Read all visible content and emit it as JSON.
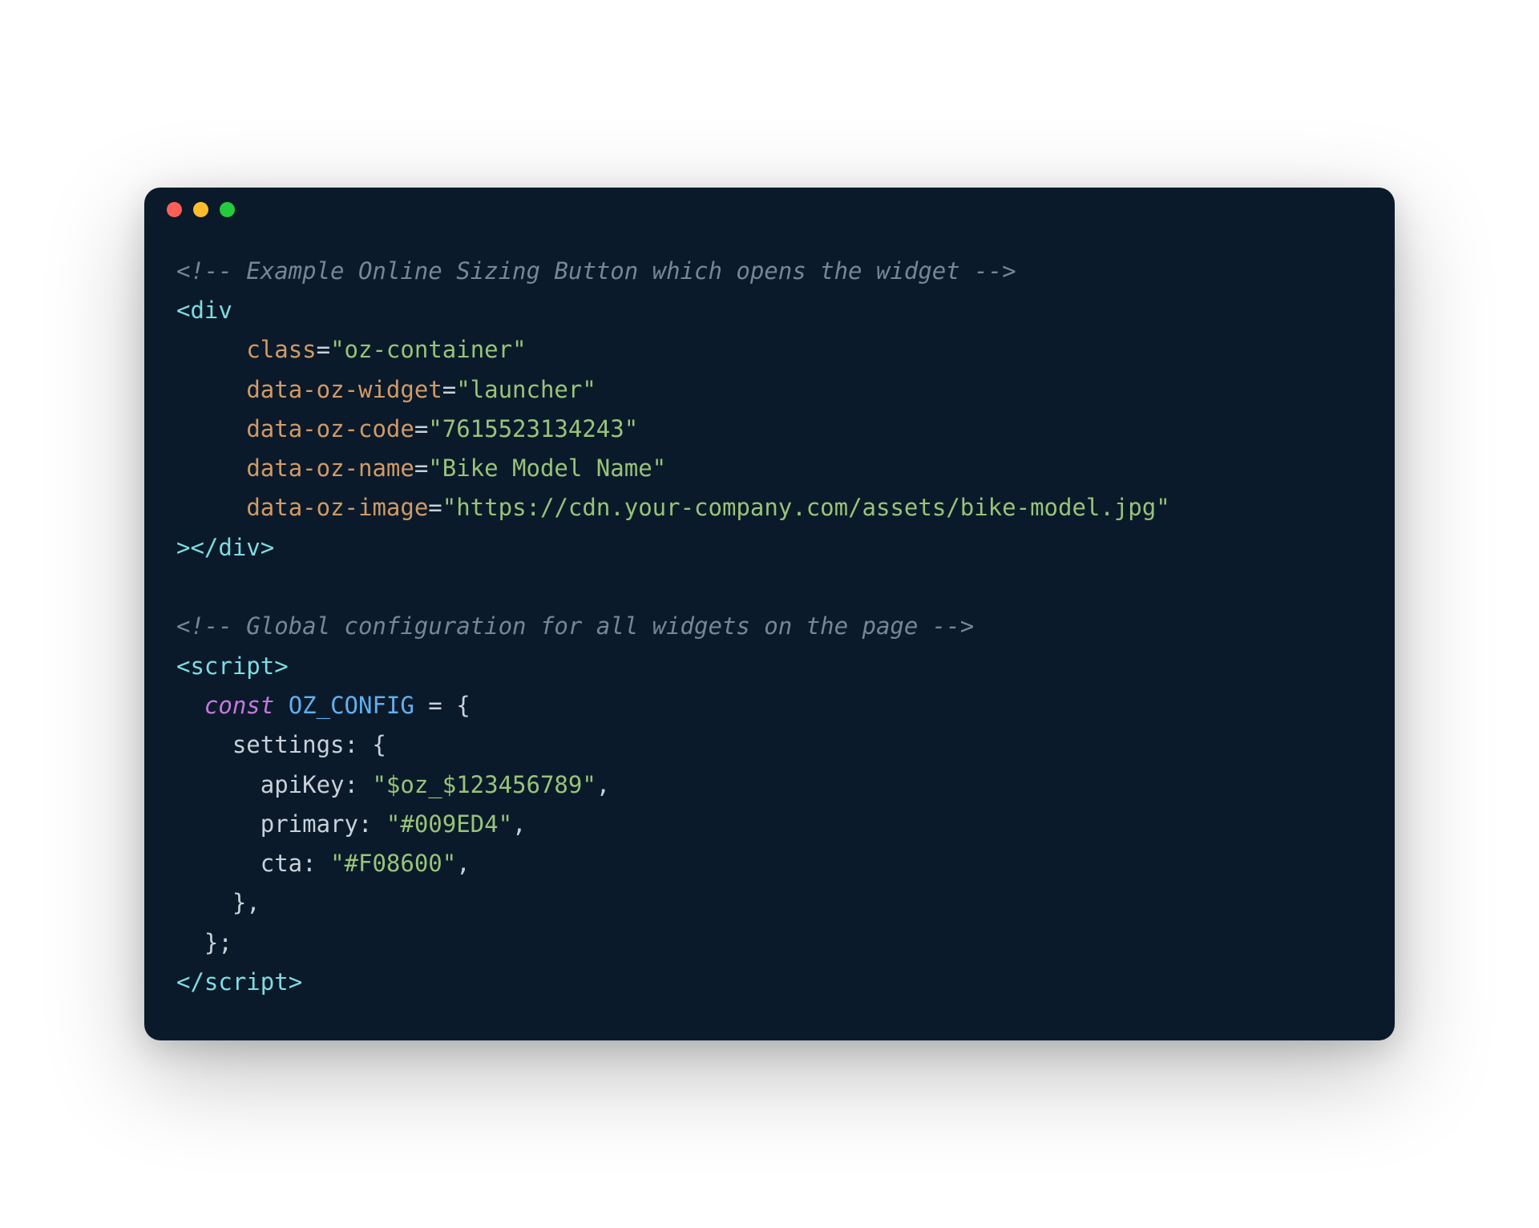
{
  "window": {
    "traffic_lights": {
      "red": "#ff5f56",
      "yellow": "#ffbd2e",
      "green": "#27c93f"
    }
  },
  "code": {
    "line01_comment": "<!-- Example Online Sizing Button which opens the widget -->",
    "line02_tag_open": "<",
    "line02_tag_name": "div",
    "line03_attr": "class",
    "line03_val": "\"oz-container\"",
    "line04_attr": "data-oz-widget",
    "line04_val": "\"launcher\"",
    "line05_attr": "data-oz-code",
    "line05_val": "\"7615523134243\"",
    "line06_attr": "data-oz-name",
    "line06_val": "\"Bike Model Name\"",
    "line07_attr": "data-oz-image",
    "line07_val": "\"https://cdn.your-company.com/assets/bike-model.jpg\"",
    "line08_close_open": ">",
    "line08_close_slash": "</",
    "line08_close_name": "div",
    "line08_close_end": ">",
    "line10_comment": "<!-- Global configuration for all widgets on the page -->",
    "line11_open": "<",
    "line11_name": "script",
    "line11_end": ">",
    "line12_kw": "const",
    "line12_const": " OZ_CONFIG ",
    "line12_eq": "= {",
    "line13_prop": "    settings",
    "line13_punc": ": {",
    "line14_prop": "      apiKey",
    "line14_punc": ": ",
    "line14_val": "\"$oz_$123456789\"",
    "line14_comma": ",",
    "line15_prop": "      primary",
    "line15_punc": ": ",
    "line15_val": "\"#009ED4\"",
    "line15_comma": ",",
    "line16_prop": "      cta",
    "line16_punc": ": ",
    "line16_val": "\"#F08600\"",
    "line16_comma": ",",
    "line17": "    },",
    "line18": "  };",
    "line19_open": "</",
    "line19_name": "script",
    "line19_end": ">"
  }
}
